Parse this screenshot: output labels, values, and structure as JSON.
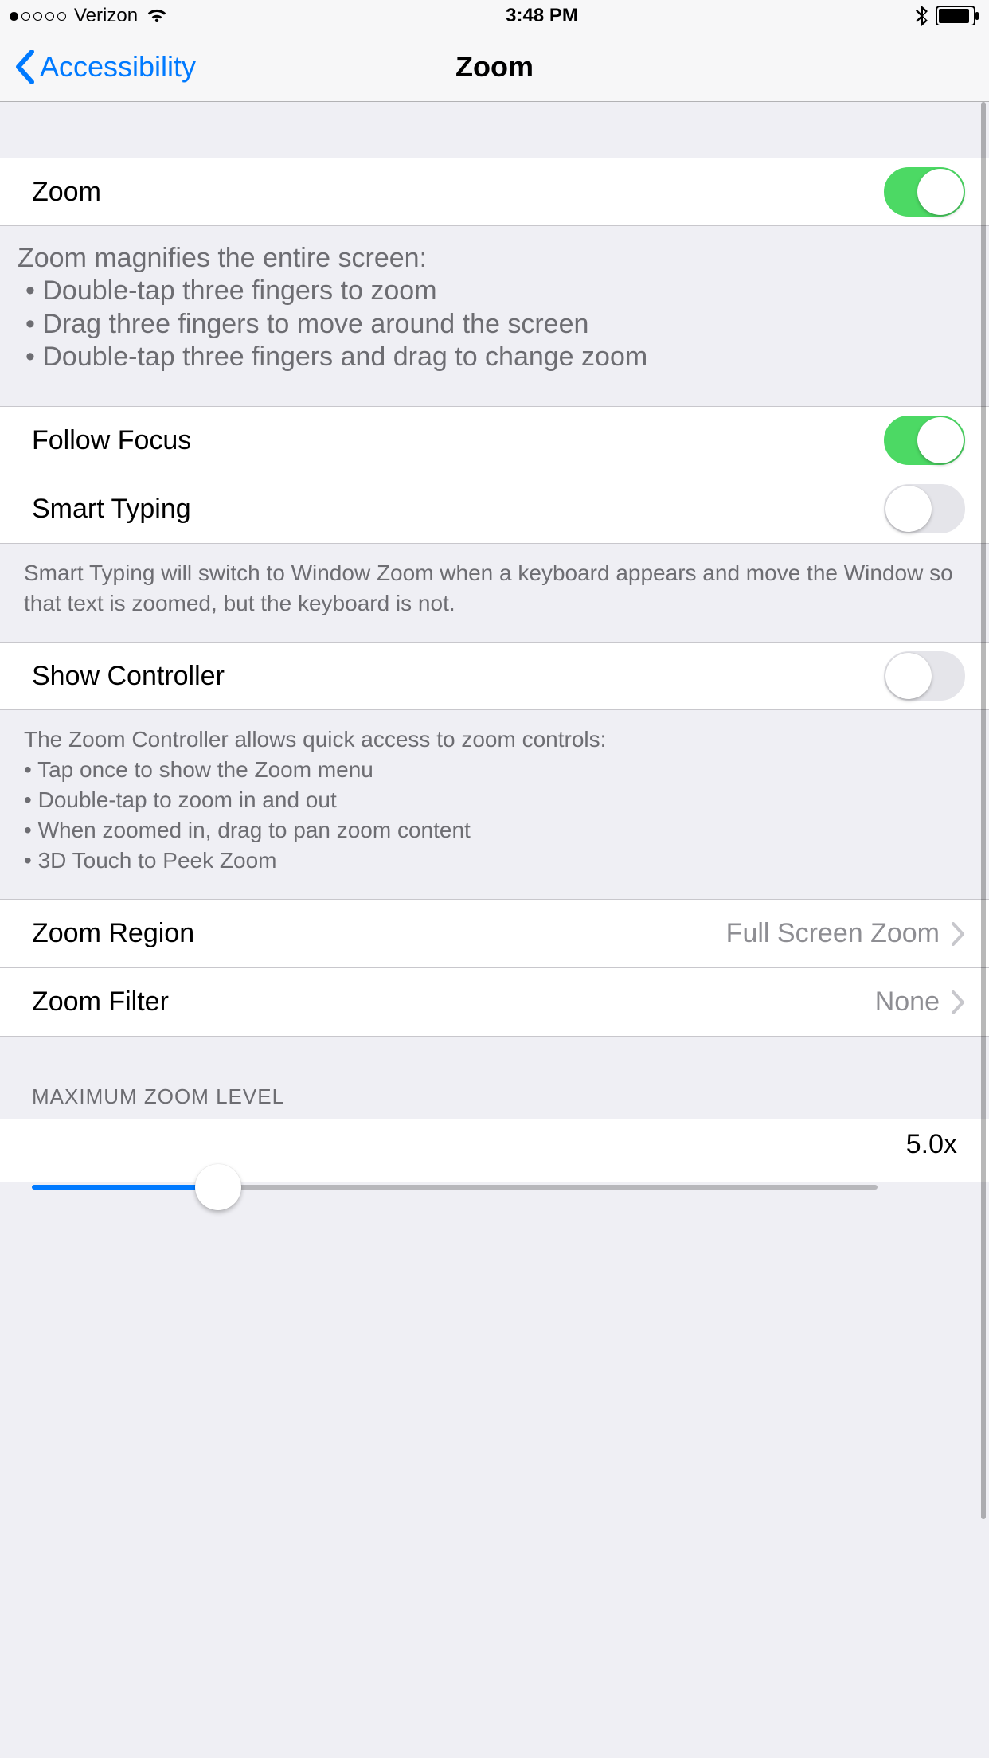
{
  "status": {
    "carrier": "Verizon",
    "time": "3:48 PM"
  },
  "nav": {
    "back_label": "Accessibility",
    "title": "Zoom"
  },
  "rows": {
    "zoom": {
      "label": "Zoom",
      "on": true
    },
    "follow_focus": {
      "label": "Follow Focus",
      "on": true
    },
    "smart_typing": {
      "label": "Smart Typing",
      "on": false
    },
    "show_controller": {
      "label": "Show Controller",
      "on": false
    },
    "zoom_region": {
      "label": "Zoom Region",
      "value": "Full Screen Zoom"
    },
    "zoom_filter": {
      "label": "Zoom Filter",
      "value": "None"
    }
  },
  "desc": {
    "zoom_head": "Zoom magnifies the entire screen:",
    "zoom_b1": "Double-tap three fingers to zoom",
    "zoom_b2": "Drag three fingers to move around the screen",
    "zoom_b3": "Double-tap three fingers and drag to change zoom",
    "smart_typing": "Smart Typing will switch to Window Zoom when a keyboard appears and move the Window so that text is zoomed, but the keyboard is not.",
    "controller_head": "The Zoom Controller allows quick access to zoom controls:",
    "controller_b1": "Tap once to show the Zoom menu",
    "controller_b2": "Double-tap to zoom in and out",
    "controller_b3": "When zoomed in, drag to pan zoom content",
    "controller_b4": "3D Touch to Peek Zoom"
  },
  "sections": {
    "max_zoom": "MAXIMUM ZOOM LEVEL"
  },
  "slider": {
    "value_label": "5.0x",
    "percent": 22
  }
}
